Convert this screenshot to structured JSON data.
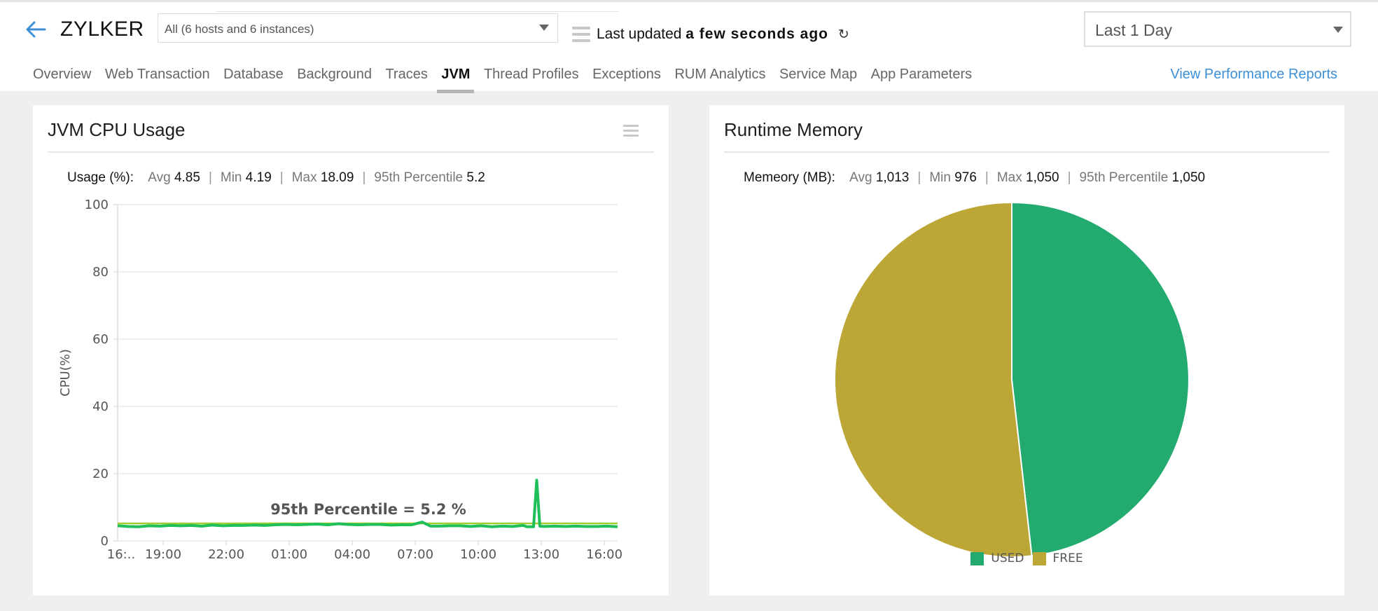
{
  "header": {
    "app_name": "ZYLKER",
    "host_selector": "All (6 hosts and 6 instances)",
    "last_updated_prefix": "Last updated",
    "last_updated_value": "a few seconds ago",
    "time_range": "Last 1 Day",
    "icons": {
      "back": "arrow-left-icon",
      "menu": "hamburger-icon",
      "refresh": "refresh-icon",
      "dropdown": "caret-down-icon"
    }
  },
  "tabs": [
    {
      "label": "Overview",
      "active": false
    },
    {
      "label": "Web Transaction",
      "active": false
    },
    {
      "label": "Database",
      "active": false
    },
    {
      "label": "Background",
      "active": false
    },
    {
      "label": "Traces",
      "active": false
    },
    {
      "label": "JVM",
      "active": true
    },
    {
      "label": "Thread Profiles",
      "active": false
    },
    {
      "label": "Exceptions",
      "active": false
    },
    {
      "label": "RUM Analytics",
      "active": false
    },
    {
      "label": "Service Map",
      "active": false
    },
    {
      "label": "App Parameters",
      "active": false
    }
  ],
  "performance_reports_link": "View Performance Reports",
  "colors": {
    "accent_link": "#3d8fd6",
    "cpu_line": "#1fbf5a",
    "percentile_line": "#9ccf2f",
    "used": "#23aa6e",
    "free": "#bca635"
  },
  "cpu_panel": {
    "title": "JVM CPU Usage",
    "stats": {
      "heading": "Usage (%):",
      "items": [
        {
          "label": "Avg",
          "value": "4.85"
        },
        {
          "label": "Min",
          "value": "4.19"
        },
        {
          "label": "Max",
          "value": "18.09"
        },
        {
          "label": "95th Percentile",
          "value": "5.2"
        }
      ]
    }
  },
  "memory_panel": {
    "title": "Runtime Memory",
    "stats": {
      "heading": "Memeory (MB):",
      "items": [
        {
          "label": "Avg",
          "value": "1,013"
        },
        {
          "label": "Min",
          "value": "976"
        },
        {
          "label": "Max",
          "value": "1,050"
        },
        {
          "label": "95th Percentile",
          "value": "1,050"
        }
      ]
    }
  },
  "chart_data": [
    {
      "type": "line",
      "title": "JVM CPU Usage",
      "xlabel": "",
      "ylabel": "CPU(%)",
      "ylim": [
        0,
        100
      ],
      "yticks": [
        0,
        20,
        40,
        60,
        80,
        100
      ],
      "xlim_hours": [
        0,
        23.8
      ],
      "xticks": [
        {
          "label": "16:..",
          "hour": 0
        },
        {
          "label": "19:00",
          "hour": 2.17
        },
        {
          "label": "22:00",
          "hour": 5.17
        },
        {
          "label": "01:00",
          "hour": 8.17
        },
        {
          "label": "04:00",
          "hour": 11.17
        },
        {
          "label": "07:00",
          "hour": 14.17
        },
        {
          "label": "10:00",
          "hour": 17.17
        },
        {
          "label": "13:00",
          "hour": 20.17
        },
        {
          "label": "16:00",
          "hour": 23.17
        }
      ],
      "grid": true,
      "series": [
        {
          "name": "CPU Usage",
          "x_hours": [
            0,
            0.5,
            1.0,
            1.5,
            2.0,
            2.5,
            3.0,
            3.5,
            4.0,
            4.5,
            5.0,
            5.5,
            6.0,
            6.5,
            7.0,
            7.5,
            8.0,
            8.5,
            9.0,
            9.5,
            10.0,
            10.5,
            11.0,
            11.5,
            12.0,
            12.5,
            13.0,
            13.5,
            14.0,
            14.5,
            14.9,
            15.3,
            15.8,
            16.3,
            16.8,
            17.3,
            17.8,
            18.3,
            18.8,
            19.3,
            19.5,
            19.8,
            19.95,
            20.1,
            20.3,
            20.8,
            21.3,
            21.8,
            22.3,
            22.8,
            23.3,
            23.8
          ],
          "values": [
            4.5,
            4.3,
            4.2,
            4.5,
            4.4,
            4.6,
            4.5,
            4.6,
            4.4,
            4.7,
            4.5,
            4.6,
            4.6,
            4.7,
            4.6,
            4.8,
            4.9,
            4.8,
            4.9,
            5.0,
            4.8,
            5.1,
            4.9,
            4.8,
            4.9,
            4.9,
            4.7,
            4.8,
            4.8,
            5.6,
            4.4,
            4.4,
            4.5,
            4.5,
            4.3,
            4.5,
            4.2,
            4.4,
            4.3,
            4.6,
            4.2,
            4.2,
            18.09,
            4.4,
            4.3,
            4.4,
            4.3,
            4.4,
            4.3,
            4.3,
            4.4,
            4.2
          ]
        }
      ],
      "reference_lines": [
        {
          "name": "95th Percentile",
          "value": 5.2,
          "label": "95th Percentile = 5.2 %"
        }
      ]
    },
    {
      "type": "pie",
      "title": "Runtime Memory",
      "categories": [
        "USED",
        "FREE"
      ],
      "values": [
        48.2,
        51.8
      ],
      "unit": "%",
      "legend": "bottom-center"
    }
  ]
}
